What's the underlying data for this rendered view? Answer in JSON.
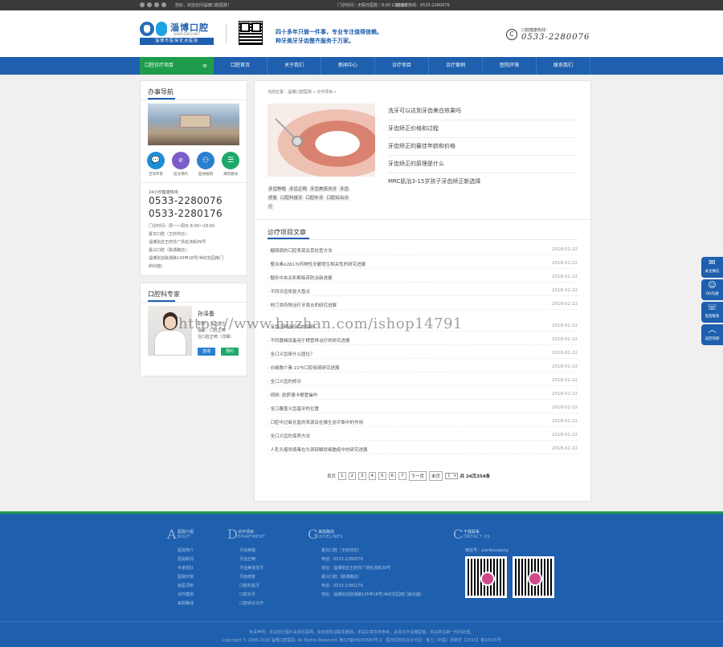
{
  "topbar": {
    "greeting": "您好，欢迎访问淄博口腔医院！",
    "hours": "门诊时间｜无假日医院｜8:00 – 18:00",
    "health_tel": "口腔健康热线：0533-2280076"
  },
  "header": {
    "logo_name": "淄博口腔",
    "logo_eng": "WWW.ZBKQ.NET",
    "logo_tagline": "淄博市医保定点医院",
    "slogan_line1": "四十多年只做一件事，专业专注值得信赖。",
    "slogan_line2": "种牙美牙牙齿整齐服务于万家。",
    "hotline_label": "口腔健康热线：",
    "hotline_number": "0533-2280076"
  },
  "nav": {
    "category": "口腔诊疗项目",
    "category_icon": "≡",
    "items": [
      "口腔首页",
      "关于我们",
      "新闻中心",
      "诊疗项目",
      "诊疗案例",
      "医院环境",
      "联系我们"
    ]
  },
  "sidebar": {
    "guide_title": "办事导航",
    "quick": [
      {
        "label": "咨询专家",
        "icon": "chat-icon",
        "color": "#1e8fd6",
        "glyph": "💬"
      },
      {
        "label": "挂号预约",
        "icon": "register-icon",
        "color": "#7b5cc9",
        "glyph": "e"
      },
      {
        "label": "医保报销",
        "icon": "insurance-icon",
        "color": "#2a7fd0",
        "glyph": "⚇"
      },
      {
        "label": "来院路线",
        "icon": "route-icon",
        "color": "#1ea86a",
        "glyph": "☰"
      }
    ],
    "hours_label": "24小时健康热线：",
    "phone1": "0533-2280076",
    "phone2": "0533-2280176",
    "lines": [
      "门诊时间：周一～周日 8:00～18:00",
      "夏日口腔（王府井店）：",
      "淄博张店王府井广场名流街39号",
      "夏兴口腔（联通路店）：",
      "淄博张店联通路145甲18号(世纪花园南门",
      "斜对面)"
    ],
    "expert_title": "口腔科专家",
    "doctor_name": "孙泽备",
    "doctor_title1": "职称：主治医生",
    "doctor_title2": "擅长：口腔正畸",
    "doctor_title3": "在口腔正畸（详细）",
    "btn_consult": "咨询",
    "btn_book": "预约"
  },
  "main": {
    "breadcrumb": "当前位置：淄博口腔医院 » 诊疗项目 »",
    "tags_line1": [
      "牙齿种植",
      "牙齿正畸",
      "牙齿美容洗牙",
      "牙齿"
    ],
    "tags_line2": [
      "修复",
      "口腔科拔牙",
      "口腔补牙",
      "口腔综合诊"
    ],
    "tags_line3": [
      "疗"
    ],
    "featured": [
      "洗牙可以达到牙齿美白效果吗",
      "牙齿矫正价格和过程",
      "牙齿矫正的最佳年龄和价格",
      "牙齿矫正的原理是什么",
      "MRC肌治3-15岁孩子牙齿矫正新选择"
    ],
    "section_title": "诊疗项目文章",
    "articles": [
      {
        "title": "· 糖尿病的口腔表现及其检查方法",
        "date": "2018-02-22"
      },
      {
        "title": "· 整合素α2β1与药物性牙龈增生相关性的研究进展",
        "date": "2018-02-22"
      },
      {
        "title": "· 髓形中夹尖折断临床防治新进展",
        "date": "2018-02-22"
      },
      {
        "title": "· 不同牙齿修复大盘点",
        "date": "2018-02-22"
      },
      {
        "title": "· 他汀类药物治疗牙周炎的研究进展",
        "date": "2018-02-22"
      },
      {
        "title": "· 牙齿正畸治疗后的保持",
        "date": "2018-02-22"
      },
      {
        "title": "· 不同器械设备用于根管再治疗的研究进展",
        "date": "2018-02-22"
      },
      {
        "title": "· 全口义齿牵什么固位？",
        "date": "2018-02-22"
      },
      {
        "title": "· 白细胞介素-22与口腔疾病研究进展",
        "date": "2018-02-22"
      },
      {
        "title": "· 全口义齿的修牙",
        "date": "2018-02-22"
      },
      {
        "title": "· 视频: 欧萨德卡根管操作",
        "date": "2018-02-22"
      },
      {
        "title": "· 全口覆盖义齿基牙的位置",
        "date": "2018-02-22"
      },
      {
        "title": "· 口腔中过氧化氢的来源及在微生态平衡中的作用",
        "date": "2018-02-22"
      },
      {
        "title": "· 全口义齿的保养方法",
        "date": "2018-02-22"
      },
      {
        "title": "· 人乳头瘤状病毒在头颈部鳞状细胞癌中的研究进展",
        "date": "2018-02-22"
      }
    ],
    "pager": {
      "first": "首页",
      "pages": [
        "1",
        "2",
        "3",
        "4",
        "5",
        "6",
        "7"
      ],
      "next": "下一页",
      "last": "末页",
      "select_value": "1",
      "summary": "共 24页354条"
    }
  },
  "footer": {
    "cols": [
      {
        "letter": "A",
        "cn": "医院介绍",
        "en": "BOUT",
        "links": [
          "医院简介",
          "医院新闻",
          "专家团队",
          "医院环境",
          "就医须知",
          "诊疗案例",
          "来院路线"
        ]
      },
      {
        "letter": "D",
        "cn": "诊疗项目",
        "en": "EPARTMENT",
        "links": [
          "牙齿种植",
          "牙齿正畸",
          "牙齿美容洗牙",
          "牙齿修复",
          "口腔科拔牙",
          "口腔补牙",
          "口腔综合诊疗"
        ]
      },
      {
        "letter": "G",
        "cn": "来院路线",
        "en": "UIDELINES",
        "links": [
          "夏日口腔（王府井店）",
          "电话：0533-2280076",
          "地址：淄博张店王府井广场名流街39号",
          "夏兴口腔（联通路店）",
          "电话：0533-2280176",
          "地址：淄博张店联通路145甲18号(世纪花园南门斜对面)"
        ]
      },
      {
        "letter": "C",
        "cn": "于我联系",
        "en": "ONTACT US",
        "links": [
          "微信号：xiarikouqiang"
        ]
      }
    ],
    "copyright1": "免责声明：本站部分图片来源互联网，如有侵权请联系删除，本站文章仅供参考，具体诊疗请遵医嘱，本站将在第一时间处理。",
    "copyright2": "Copyright © 1996-2018 淄博口腔医院. All Rights Reserved.  鲁ICP备06030569号-2  ·  医疗机构执业许可证  ·  鲁卫（中医）网审字【2015】第10016号"
  },
  "float_bar": [
    {
      "label": "关注微信",
      "glyph": "✉"
    },
    {
      "label": "QQ沟通",
      "glyph": "☺"
    },
    {
      "label": "电话联系",
      "glyph": "☏"
    },
    {
      "label": "返回顶部",
      "glyph": "︿"
    }
  ],
  "watermark": "https://www.huzhan.com/ishop14791"
}
